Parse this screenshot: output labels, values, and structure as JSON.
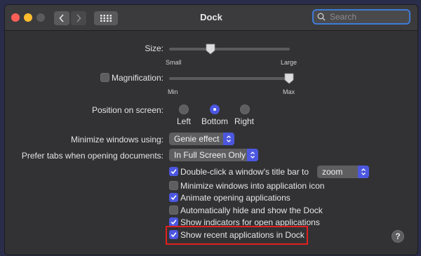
{
  "window": {
    "title": "Dock",
    "search_placeholder": "Search"
  },
  "size": {
    "label": "Size:",
    "min_label": "Small",
    "max_label": "Large",
    "value": 0.35
  },
  "magnification": {
    "label": "Magnification:",
    "checked": false,
    "min_label": "Min",
    "max_label": "Max",
    "value": 1.0
  },
  "position": {
    "label": "Position on screen:",
    "options": [
      "Left",
      "Bottom",
      "Right"
    ],
    "selected": "Bottom"
  },
  "minimize": {
    "label": "Minimize windows using:",
    "value": "Genie effect"
  },
  "prefer_tabs": {
    "label": "Prefer tabs when opening documents:",
    "value": "In Full Screen Only"
  },
  "checkboxes": [
    {
      "label": "Double-click a window's title bar to",
      "checked": true
    },
    {
      "label": "Minimize windows into application icon",
      "checked": false
    },
    {
      "label": "Animate opening applications",
      "checked": true
    },
    {
      "label": "Automatically hide and show the Dock",
      "checked": false
    },
    {
      "label": "Show indicators for open applications",
      "checked": true
    },
    {
      "label": "Show recent applications in Dock",
      "checked": true
    }
  ],
  "double_click_action": {
    "value": "zoom"
  },
  "help": {
    "label": "?"
  },
  "colors": {
    "accent": "#4c57e0",
    "highlight_border": "#e02020",
    "search_focus": "#3e7bd6"
  }
}
